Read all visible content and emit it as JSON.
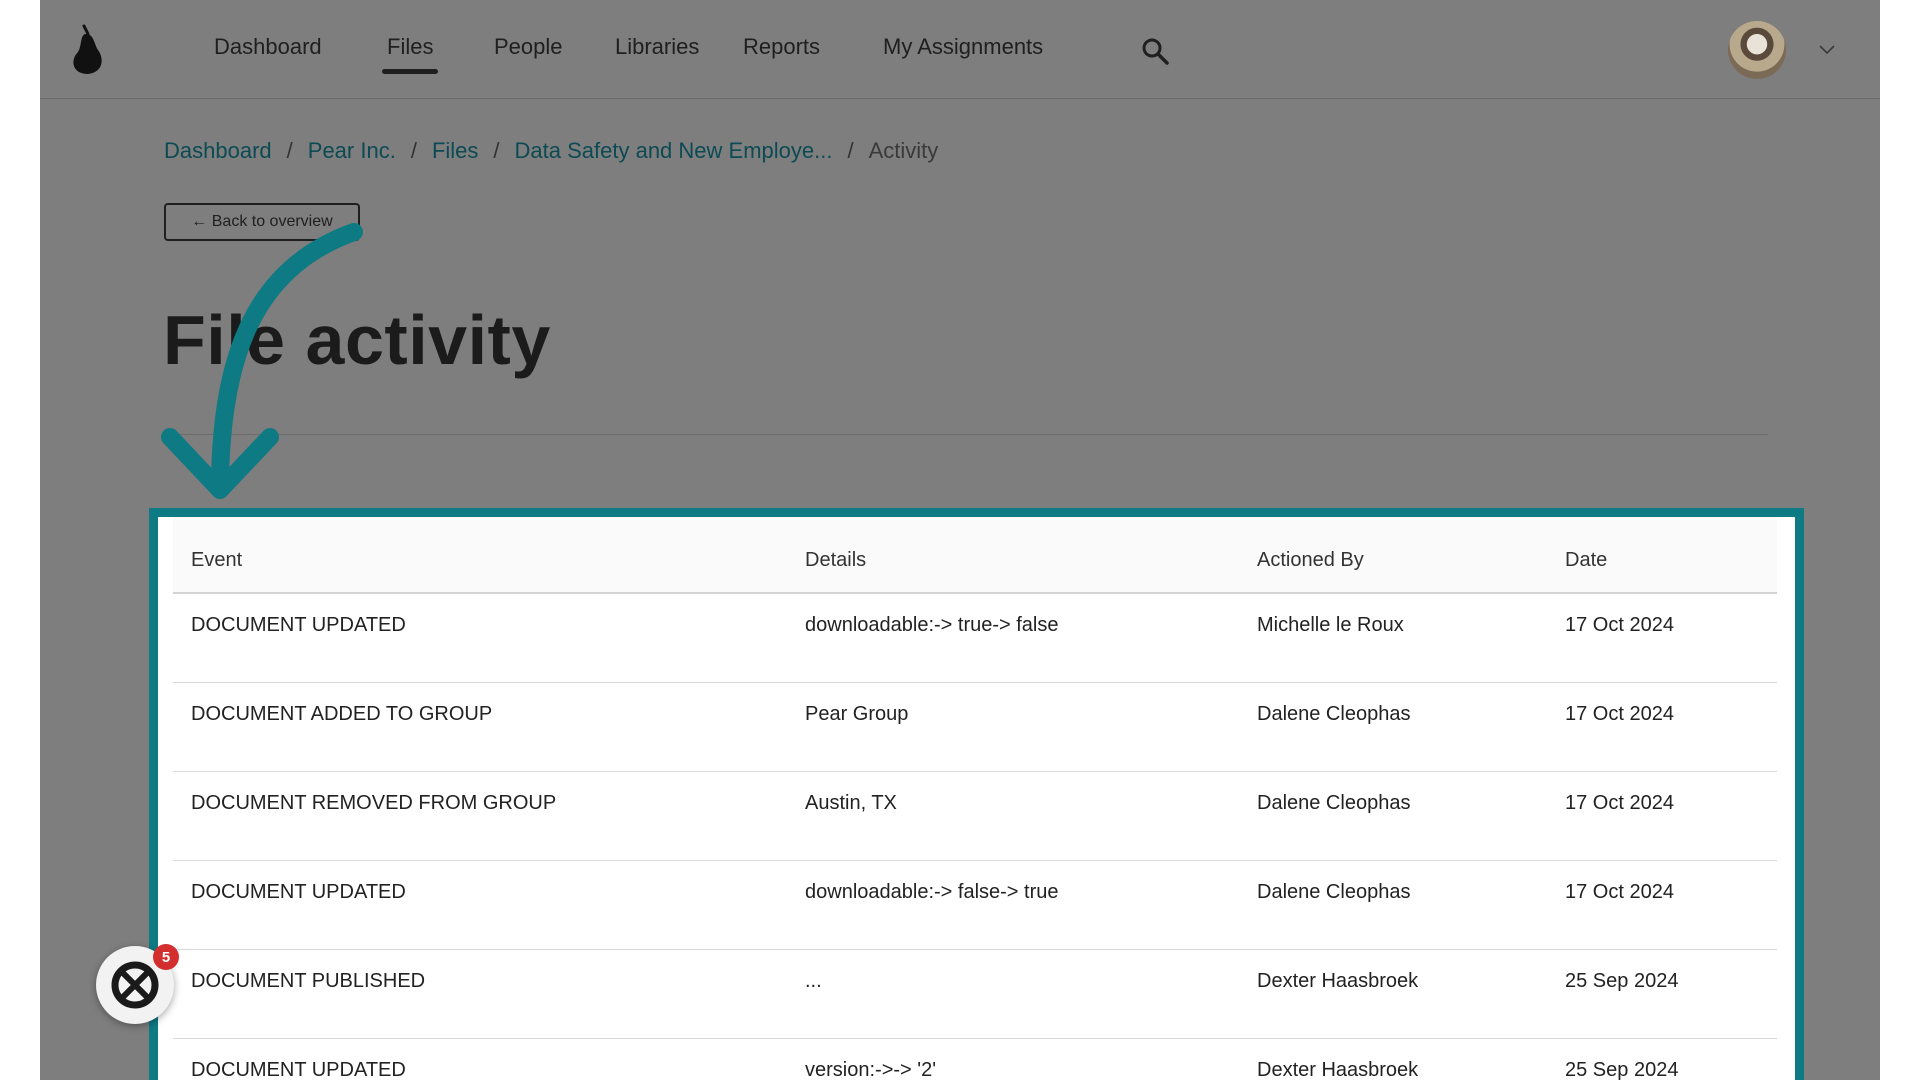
{
  "nav": {
    "items": [
      {
        "label": "Dashboard",
        "active": false
      },
      {
        "label": "Files",
        "active": true
      },
      {
        "label": "People",
        "active": false
      },
      {
        "label": "Libraries",
        "active": false
      },
      {
        "label": "Reports",
        "active": false
      },
      {
        "label": "My Assignments",
        "active": false
      }
    ],
    "search_icon": "search-icon",
    "avatar": "user-avatar",
    "menu_icon": "chevron-down-icon"
  },
  "breadcrumb": {
    "items": [
      "Dashboard",
      "Pear Inc.",
      "Files",
      "Data Safety and New Employe..."
    ],
    "current": "Activity",
    "separator": "/"
  },
  "back_button": "← Back to overview",
  "page_title": "File activity",
  "table": {
    "headers": [
      "Event",
      "Details",
      "Actioned By",
      "Date"
    ],
    "rows": [
      [
        "DOCUMENT UPDATED",
        "downloadable:-> true-> false",
        "Michelle le Roux",
        "17 Oct 2024"
      ],
      [
        "DOCUMENT ADDED TO GROUP",
        "Pear Group",
        "Dalene Cleophas",
        "17 Oct 2024"
      ],
      [
        "DOCUMENT REMOVED FROM GROUP",
        "Austin, TX",
        "Dalene Cleophas",
        "17 Oct 2024"
      ],
      [
        "DOCUMENT UPDATED",
        "downloadable:-> false-> true",
        "Dalene Cleophas",
        "17 Oct 2024"
      ],
      [
        "DOCUMENT PUBLISHED",
        "...",
        "Dexter Haasbroek",
        "25 Sep 2024"
      ],
      [
        "DOCUMENT UPDATED",
        "version:->-> '2'",
        "Dexter Haasbroek",
        "25 Sep 2024"
      ]
    ]
  },
  "chat_widget": {
    "badge_count": "5"
  },
  "colors": {
    "accent": "#0e7a84",
    "link": "#0c4a54",
    "overlay": "#7e7e7e",
    "badge": "#d32f2f"
  }
}
